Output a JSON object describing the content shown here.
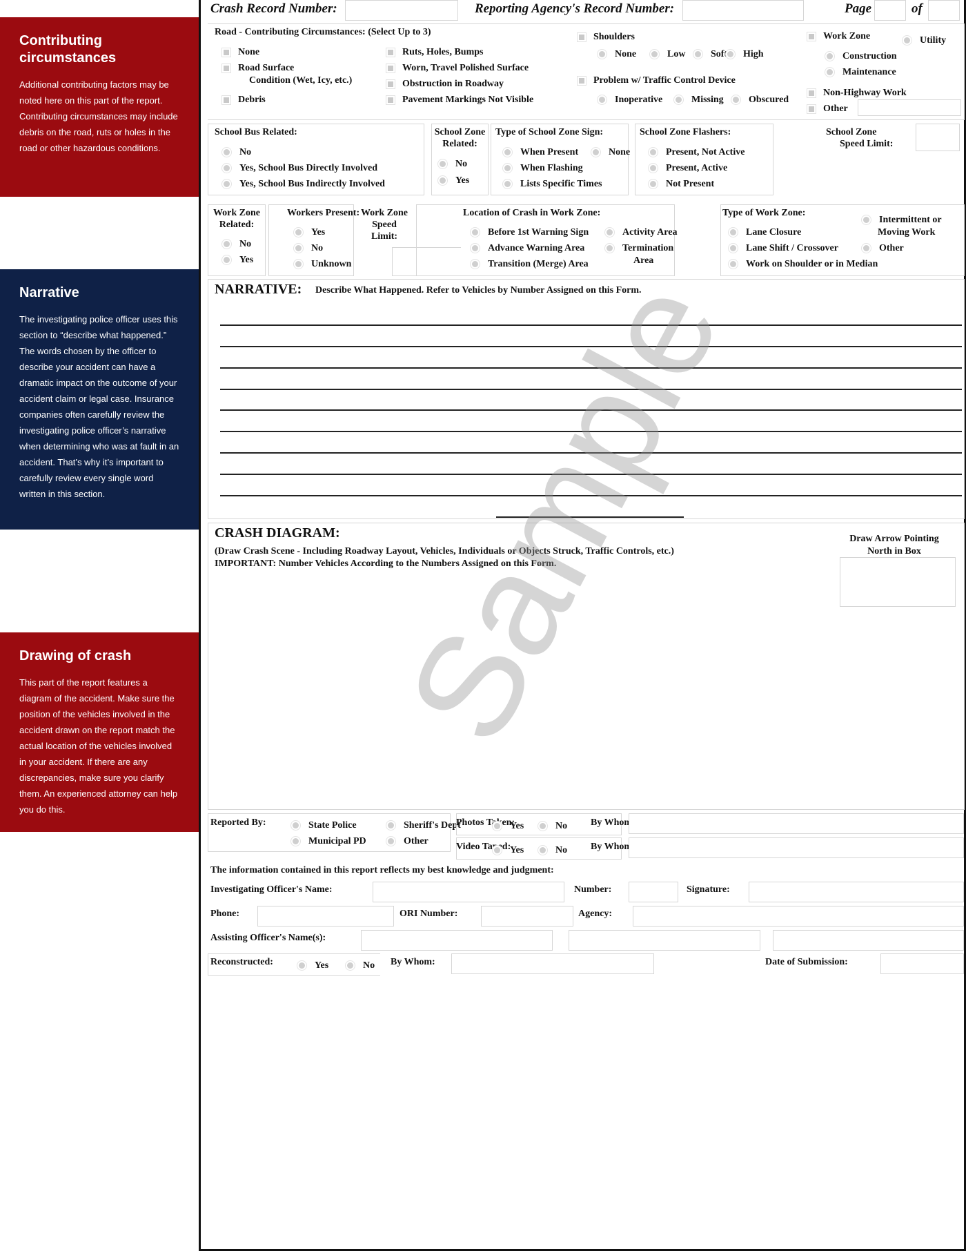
{
  "callouts": [
    {
      "title": "Contributing circumstances",
      "body": "Additional contributing factors may be noted here on this part of the report. Contributing circumstances may include debris on the road, ruts or holes in the road or other hazardous conditions.",
      "color": "#9b0b10"
    },
    {
      "title": "Narrative",
      "body": "The investigating police officer uses this section to “describe what happened.” The words chosen by the officer to describe your accident can have a dramatic impact on the outcome of your accident claim or legal case. Insurance companies often carefully review the investigating police officer’s narrative when determining who was at fault in an accident. That’s why it’s important to carefully review every single word written in this section.",
      "color": "#0f2147"
    },
    {
      "title": "Drawing of crash",
      "body": "This part of the report features a diagram of the accident. Make sure the position of the vehicles involved in the accident drawn on the report match the actual location of the vehicles involved in your accident. If there are any discrepancies, make sure you clarify them. An experienced attorney can help you do this.",
      "color": "#9b0b10"
    }
  ],
  "header": {
    "crash_record_label": "Crash Record Number:",
    "agency_record_label": "Reporting Agency's Record Number:",
    "page_label": "Page",
    "of_label": "of",
    "crash_record_value": "",
    "agency_record_value": "",
    "page_value": "",
    "of_value": ""
  },
  "road": {
    "title": "Road - Contributing Circumstances: (Select Up to 3)",
    "col1": [
      "None",
      "Road Surface",
      "Debris"
    ],
    "road_surface_sub": "Condition (Wet, Icy, etc.)",
    "col2": [
      "Ruts, Holes, Bumps",
      "Worn, Travel Polished Surface",
      "Obstruction in Roadway",
      "Pavement Markings Not Visible"
    ],
    "shoulders": {
      "label": "Shoulders",
      "options": [
        "None",
        "Low",
        "Soft",
        "High"
      ]
    },
    "traffic_device": {
      "label": "Problem w/ Traffic Control Device",
      "options": [
        "Inoperative",
        "Missing",
        "Obscured"
      ]
    },
    "work_zone": {
      "label": "Work Zone",
      "options": [
        "Utility",
        "Construction",
        "Maintenance"
      ]
    },
    "non_highway": "Non-Highway Work",
    "other": "Other",
    "other_value": ""
  },
  "school": {
    "bus": {
      "title": "School Bus Related:",
      "options": [
        "No",
        "Yes, School Bus Directly Involved",
        "Yes, School Bus Indirectly Involved"
      ]
    },
    "zone_related": {
      "title": "School Zone Related:",
      "title1": "School Zone",
      "title2": "Related:",
      "options": [
        "No",
        "Yes"
      ]
    },
    "sign": {
      "title": "Type of School Zone Sign:",
      "options": [
        "When Present",
        "None",
        "When Flashing",
        "Lists Specific Times"
      ]
    },
    "flashers": {
      "title": "School Zone Flashers:",
      "options": [
        "Present, Not Active",
        "Present, Active",
        "Not Present"
      ]
    },
    "speed": {
      "title1": "School Zone",
      "title2": "Speed Limit:",
      "value": ""
    }
  },
  "workzone": {
    "related": {
      "title1": "Work Zone",
      "title2": "Related:",
      "options": [
        "No",
        "Yes"
      ]
    },
    "workers": {
      "title": "Workers Present:",
      "options": [
        "Yes",
        "No",
        "Unknown"
      ]
    },
    "speed": {
      "title1": "Work Zone",
      "title2": "Speed",
      "title3": "Limit:",
      "value": ""
    },
    "location": {
      "title": "Location of Crash in Work Zone:",
      "options": [
        "Before 1st Warning Sign",
        "Advance Warning Area",
        "Transition (Merge) Area",
        "Activity Area",
        "Termination"
      ],
      "termination_sub": "Area"
    },
    "type": {
      "title": "Type of Work Zone:",
      "options": [
        "Lane Closure",
        "Lane Shift / Crossover",
        "Work on Shoulder or in Median",
        "Intermittent or",
        "Other"
      ],
      "intermittent_sub": "Moving Work"
    }
  },
  "narrative": {
    "title": "NARRATIVE:",
    "instruction": "Describe What Happened.  Refer to Vehicles by Number Assigned on this Form."
  },
  "diagram": {
    "title": "CRASH DIAGRAM:",
    "line1": "(Draw Crash Scene - Including Roadway Layout, Vehicles, Individuals or Objects Struck, Traffic Controls, etc.)",
    "line2": "IMPORTANT:  Number Vehicles According to the Numbers Assigned on this Form.",
    "north1": "Draw Arrow Pointing",
    "north2": "North in Box"
  },
  "watermark": "Sample",
  "footer": {
    "reported_by": {
      "label": "Reported By:",
      "options": [
        "State Police",
        "Sheriff's Dept",
        "Municipal PD",
        "Other"
      ]
    },
    "photos": {
      "label": "Photos Taken:",
      "options": [
        "Yes",
        "No"
      ]
    },
    "video": {
      "label": "Video Taped:",
      "options": [
        "Yes",
        "No"
      ]
    },
    "by_whom": "By Whom:",
    "statement": "The information contained in this report reflects my best knowledge and judgment:",
    "officer_name": "Investigating Officer's Name:",
    "number": "Number:",
    "signature": "Signature:",
    "phone": "Phone:",
    "ori": "ORI Number:",
    "agency": "Agency:",
    "assisting": "Assisting Officer's Name(s):",
    "reconstructed": {
      "label": "Reconstructed:",
      "options": [
        "Yes",
        "No"
      ]
    },
    "date_submission": "Date of Submission:"
  }
}
